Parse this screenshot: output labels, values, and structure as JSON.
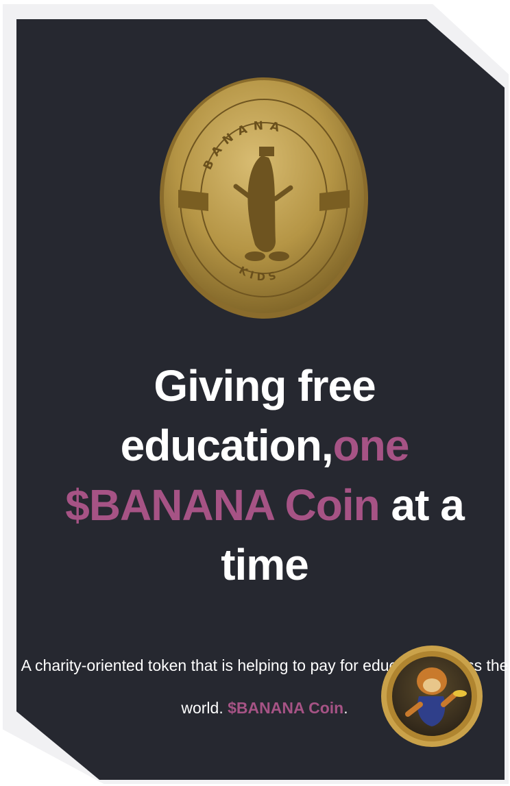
{
  "hero": {
    "headline_part1": "Giving free education,",
    "headline_accent": "one $BANANA Coin",
    "headline_part2": " at a time"
  },
  "description": {
    "text": "A charity-oriented token that is helping to pay for education across the world. ",
    "token_name": "$BANANA Coin",
    "period": "."
  },
  "coin": {
    "ring_text": "BANANA",
    "bottom_text": "KIDS"
  },
  "colors": {
    "background": "#262830",
    "accent": "#a65385",
    "gold": "#b59545"
  }
}
